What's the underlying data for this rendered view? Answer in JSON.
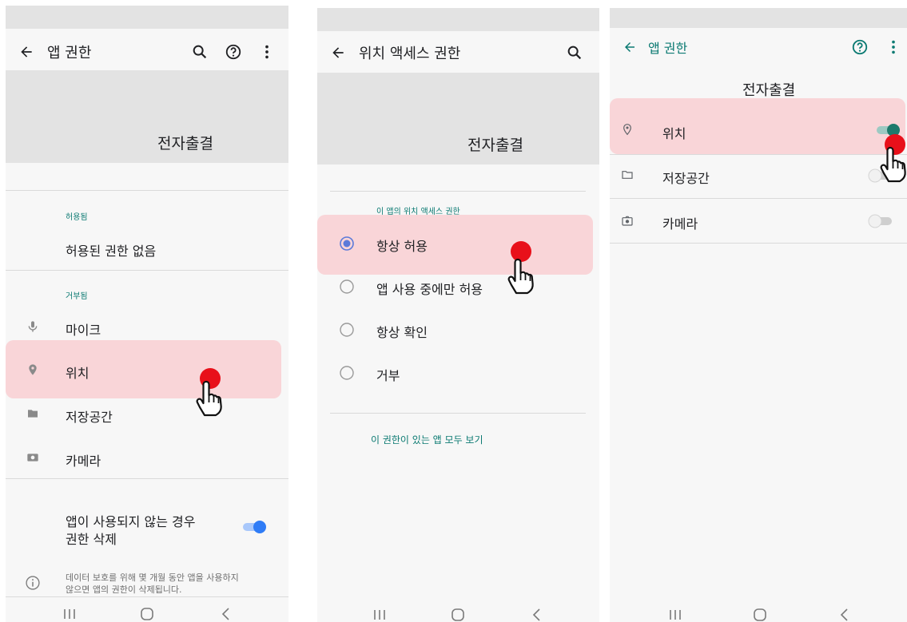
{
  "colors": {
    "accent": "#0b7a72",
    "toggle_on": "#2f7cf6",
    "highlight": "#fbd4d7",
    "tap_dot": "#e8101a"
  },
  "screen1": {
    "title": "앱 권한",
    "app_name": "전자출결",
    "allowed_header": "허용됨",
    "allowed_none": "허용된 권한 없음",
    "denied_header": "거부됨",
    "denied_items": [
      {
        "label": "마이크",
        "icon": "mic-icon"
      },
      {
        "label": "위치",
        "icon": "location-pin-icon"
      },
      {
        "label": "저장공간",
        "icon": "folder-icon"
      },
      {
        "label": "카메라",
        "icon": "camera-icon"
      }
    ],
    "remove_toggle_line1": "앱이 사용되지 않는 경우",
    "remove_toggle_line2": "권한 삭제",
    "remove_toggle_on": true,
    "info_line1": "데이터 보호를 위해 몇 개월 동안 앱을 사용하지",
    "info_line2": "않으면 앱의 권한이 삭제됩니다."
  },
  "screen2": {
    "title": "위치 액세스 권한",
    "app_name": "전자출결",
    "section_caption": "이 앱의 위치 액세스 권한",
    "options": [
      "항상 허용",
      "앱 사용 중에만 허용",
      "항상 확인",
      "거부"
    ],
    "selected_index": 0,
    "see_all": "이 권한이 있는 앱 모두 보기"
  },
  "screen3": {
    "title": "앱 권한",
    "app_name": "전자출결",
    "items": [
      {
        "label": "위치",
        "icon": "location-pin-outline-icon",
        "on": true
      },
      {
        "label": "저장공간",
        "icon": "folder-outline-icon",
        "on": false
      },
      {
        "label": "카메라",
        "icon": "camera-outline-icon",
        "on": false
      }
    ]
  },
  "navbar_icons": [
    "recent-apps-icon",
    "home-icon",
    "back-nav-icon"
  ]
}
